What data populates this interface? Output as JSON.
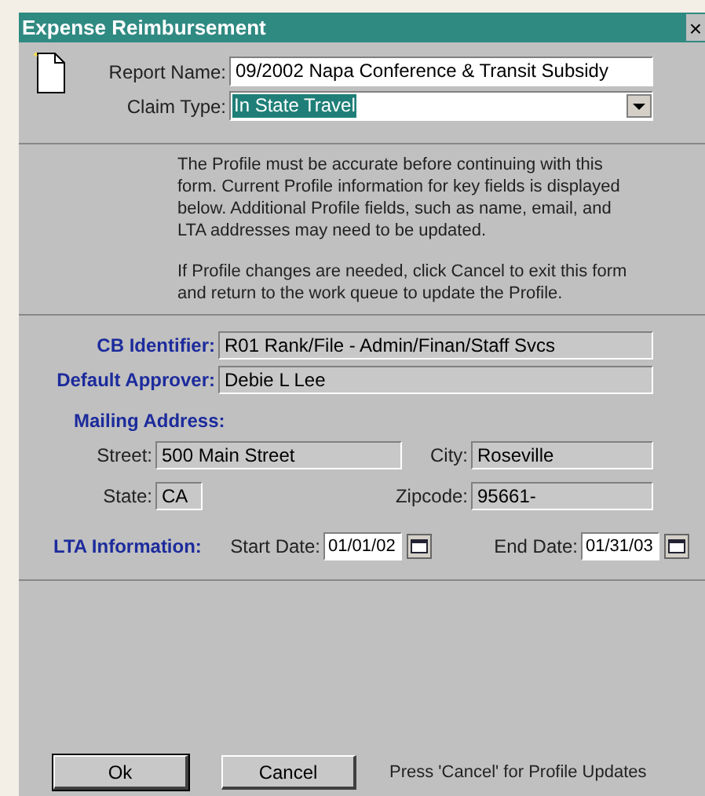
{
  "window": {
    "title": "Expense Reimbursement",
    "close": "×"
  },
  "report_name": {
    "label": "Report Name:",
    "value": "09/2002 Napa Conference & Transit Subsidy"
  },
  "claim_type": {
    "label": "Claim Type:",
    "value": "In State Travel",
    "selected_text": true
  },
  "notice": [
    "The Profile must be accurate before continuing with this form.  Current Profile information for key fields is displayed below.  Additional Profile fields, such as name, email, and LTA addresses may need to be updated.",
    "If Profile changes are needed, click Cancel to exit this form and return to the work queue to update the Profile."
  ],
  "cb_identifier": {
    "label": "CB Identifier:",
    "value": "R01 Rank/File - Admin/Finan/Staff Svcs"
  },
  "default_approver": {
    "label": "Default Approver:",
    "value": "Debie L Lee"
  },
  "mailing_address": {
    "heading": "Mailing Address:",
    "street": {
      "label": "Street:",
      "value": "500 Main Street"
    },
    "city": {
      "label": "City:",
      "value": "Roseville"
    },
    "state": {
      "label": "State:",
      "value": "CA"
    },
    "zipcode": {
      "label": "Zipcode:",
      "value": "95661-"
    }
  },
  "lta": {
    "heading": "LTA Information:",
    "start": {
      "label": "Start Date:",
      "value": "01/01/02"
    },
    "end": {
      "label": "End Date:",
      "value": "01/31/03"
    }
  },
  "buttons": [
    {
      "label": "Ok",
      "default": true
    },
    {
      "label": "Cancel",
      "default": false
    }
  ],
  "hint": "Press 'Cancel' for Profile Updates"
}
